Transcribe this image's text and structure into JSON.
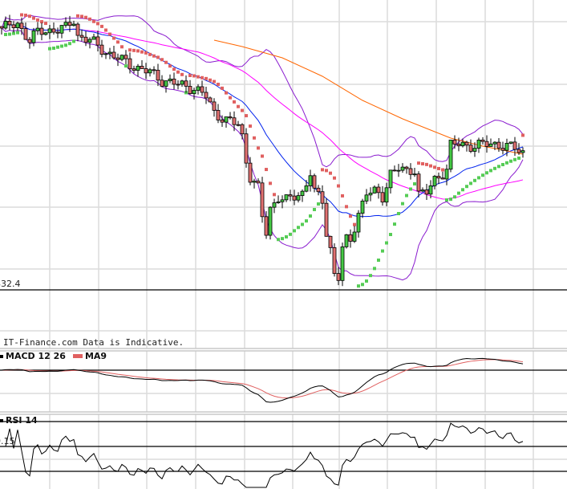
{
  "chart_data": [
    {
      "type": "candlestick",
      "title": "Price",
      "watermark": "IT-Finance.com Data is Indicative.",
      "reference_line": {
        "label": "832.4",
        "value": 832.4
      },
      "close_points": [
        [
          0,
          995.4
        ],
        [
          4,
          997.9
        ],
        [
          7,
          987.9
        ],
        [
          9,
          992.9
        ],
        [
          12,
          993.9
        ],
        [
          16,
          995.4
        ],
        [
          18,
          1000.4
        ],
        [
          19,
          990.4
        ],
        [
          22,
          987.9
        ],
        [
          26,
          980.4
        ],
        [
          30,
          975.4
        ],
        [
          34,
          970.4
        ],
        [
          37,
          967.9
        ],
        [
          40,
          962.9
        ],
        [
          44,
          960.4
        ],
        [
          48,
          957.9
        ],
        [
          51,
          952.9
        ],
        [
          53,
          942.9
        ],
        [
          56,
          937.9
        ],
        [
          59,
          935.4
        ],
        [
          60,
          927.9
        ],
        [
          61,
          912.9
        ],
        [
          62,
          902.9
        ],
        [
          64,
          895.4
        ],
        [
          65,
          877.9
        ],
        [
          66,
          867.9
        ],
        [
          67,
          882.9
        ],
        [
          69,
          890.4
        ],
        [
          71,
          887.9
        ],
        [
          73,
          890.4
        ],
        [
          75,
          892.9
        ],
        [
          77,
          905.4
        ],
        [
          78,
          892.9
        ],
        [
          80,
          887.9
        ],
        [
          81,
          867.9
        ],
        [
          82,
          857.9
        ],
        [
          83,
          842.9
        ],
        [
          84,
          840.4
        ],
        [
          85,
          857.9
        ],
        [
          86,
          862.9
        ],
        [
          87,
          862.9
        ],
        [
          89,
          880.4
        ],
        [
          91,
          892.9
        ],
        [
          93,
          892.9
        ],
        [
          95,
          890.4
        ],
        [
          97,
          905.4
        ],
        [
          99,
          907.9
        ],
        [
          101,
          905.4
        ],
        [
          103,
          907.9
        ],
        [
          104,
          892.9
        ],
        [
          106,
          892.9
        ],
        [
          108,
          900.4
        ],
        [
          110,
          905.4
        ],
        [
          111,
          907.9
        ],
        [
          112,
          922.9
        ],
        [
          114,
          922.9
        ],
        [
          116,
          921.9
        ],
        [
          119,
          922.9
        ],
        [
          122,
          922.9
        ],
        [
          124,
          922.9
        ],
        [
          126,
          921.9
        ],
        [
          128,
          920.4
        ],
        [
          130,
          917.9
        ]
      ],
      "sma200_points": [
        [
          53,
          987.9
        ],
        [
          60,
          983.9
        ],
        [
          70,
          976.9
        ],
        [
          80,
          965.4
        ],
        [
          90,
          950.4
        ],
        [
          100,
          938.9
        ],
        [
          112,
          926.9
        ],
        [
          120,
          921.9
        ],
        [
          130,
          916.9
        ]
      ],
      "indicators": [
        "Bollinger 20",
        "SMA 20",
        "SMA 50",
        "SMA 200",
        "Parabolic SAR"
      ],
      "colors": {
        "up": "#44c844",
        "down": "#e07070",
        "bb": "#8a1ccf",
        "sma20": "#0022ee",
        "sma50": "#ff00ff",
        "sma200": "#ff6600",
        "sar_up": "#55cc55",
        "sar_down": "#e06060"
      },
      "grid": true
    },
    {
      "type": "line",
      "title": "MACD 12 26",
      "legend": [
        {
          "name": "MACD 12 26",
          "color": "#000000"
        },
        {
          "name": "MA9",
          "color": "#e06060"
        }
      ],
      "zero_line": 0
    },
    {
      "type": "line",
      "title": "RSI 14",
      "level_label": "0.15",
      "levels": [
        70,
        50,
        30
      ],
      "ylim": [
        0,
        100
      ]
    }
  ]
}
